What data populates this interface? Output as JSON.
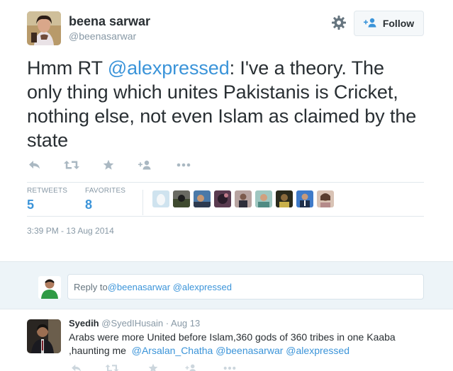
{
  "tweet": {
    "author_name": "beena sarwar",
    "author_handle": "@beenasarwar",
    "follow_label": "Follow",
    "text_parts": {
      "prefix": "Hmm RT ",
      "mention": "@alexpressed",
      "body": ": I've a theory. The only thing which unites Pakistanis is Cricket, nothing else, not even Islam as claimed by the state"
    },
    "retweets_label": "RETWEETS",
    "retweets_count": "5",
    "favorites_label": "FAVORITES",
    "favorites_count": "8",
    "timestamp": "3:39 PM - 13 Aug 2014"
  },
  "reply_box": {
    "prefix": "Reply to ",
    "mention_1": "@beenasarwar",
    "mention_2": "@alexpressed"
  },
  "reply_tweet": {
    "name": "Syedih",
    "handle": "@SyedIHusain",
    "separator": "·",
    "time": "Aug 13",
    "text_line1": "Arabs were more United before Islam,360 gods of 360 tribes in one Kaaba",
    "text_line2_prefix": ",haunting me  ",
    "mention_1": "@Arsalan_Chatha",
    "mention_2": "@beenasarwar",
    "mention_3": "@alexpressed"
  },
  "colors": {
    "link": "#3b94d9",
    "muted": "#8899a6",
    "text": "#292f33",
    "reply_bg": "#edf4f8"
  },
  "icons": {
    "actions": [
      "reply-icon",
      "retweet-icon",
      "favorite-icon",
      "follow-user-icon",
      "more-icon"
    ],
    "header": [
      "gear-icon",
      "follow-person-icon"
    ]
  }
}
